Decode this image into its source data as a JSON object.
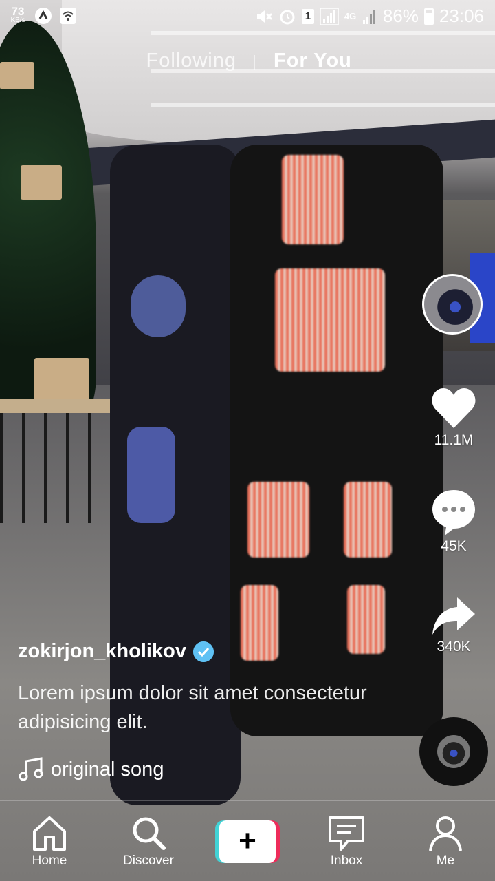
{
  "status_bar": {
    "net_speed": "73",
    "net_unit": "KB/s",
    "sim_slot": "1",
    "network": "4G",
    "battery": "86%",
    "time": "23:06"
  },
  "tabs": {
    "following": "Following",
    "for_you": "For You"
  },
  "actions": {
    "likes": "11.1M",
    "comments": "45K",
    "shares": "340K"
  },
  "post": {
    "username": "zokirjon_kholikov",
    "verified": true,
    "description": "Lorem ipsum dolor sit amet consectetur adipisicing elit.",
    "music": "original song"
  },
  "nav": {
    "home": "Home",
    "discover": "Discover",
    "create": "+",
    "inbox": "Inbox",
    "me": "Me"
  }
}
